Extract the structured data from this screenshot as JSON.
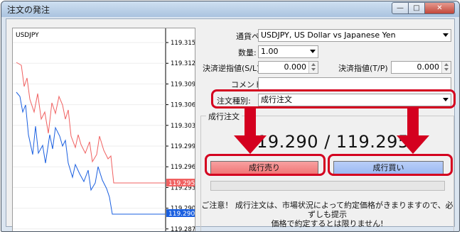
{
  "window": {
    "title": "注文の発注",
    "buttons": {
      "minimize": "—",
      "maximize": "□",
      "close": "✕"
    }
  },
  "chart": {
    "symbol": "USDJPY",
    "price_labels": [
      "119.315",
      "119.312",
      "119.309",
      "119.306",
      "119.303",
      "119.299",
      "119.296",
      "119.293",
      "119.290",
      "119.287"
    ],
    "ask_tag": "119.295",
    "bid_tag": "119.290",
    "colors": {
      "ask": "#f06060",
      "bid": "#1a5fe0",
      "ask_tag": "#f06060",
      "bid_tag": "#1a5fe0"
    }
  },
  "form": {
    "symbol_label": "通貨ペア:",
    "symbol_value": "USDJPY, US Dollar vs Japanese Yen",
    "volume_label": "数量:",
    "volume_value": "1.00",
    "sl_label": "決済逆指値(S/L)",
    "sl_value": "0.000",
    "tp_label": "決済指値(T/P)",
    "tp_value": "0.000",
    "comment_label": "コメント:",
    "comment_value": "",
    "type_label": "注文種別:",
    "type_value": "成行注文"
  },
  "market": {
    "group_title": "成行注文",
    "price_display": "119.290 / 119.295",
    "sell_label": "成行売り",
    "buy_label": "成行買い",
    "note_line1": "ご注意！ 成行注文は、市場状況によって約定価格がきまりますので、必ずしも提示",
    "note_line2": "価格で約定するとは限りません!"
  },
  "annotation_color": "#d4001f"
}
